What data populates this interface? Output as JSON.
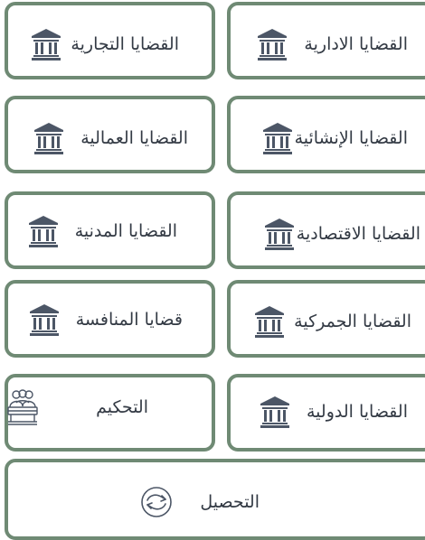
{
  "colors": {
    "card_border": "#6f8a74",
    "icon": "#4c5666",
    "text": "#333a44",
    "background": "#ffffff"
  },
  "cards": [
    {
      "label": "القضايا الادارية",
      "icon": "courthouse-icon"
    },
    {
      "label": "القضايا التجارية",
      "icon": "courthouse-icon"
    },
    {
      "label": "القضايا الإنشائية",
      "icon": "courthouse-icon"
    },
    {
      "label": "القضايا العمالية",
      "icon": "courthouse-icon"
    },
    {
      "label": "القضايا الاقتصادية",
      "icon": "courthouse-icon"
    },
    {
      "label": "القضايا المدنية",
      "icon": "courthouse-icon"
    },
    {
      "label": "القضايا الجمركية",
      "icon": "courthouse-icon"
    },
    {
      "label": "قضايا المنافسة",
      "icon": "courthouse-icon"
    },
    {
      "label": "القضايا الدولية",
      "icon": "courthouse-icon"
    },
    {
      "label": "التحكيم",
      "icon": "arbitration-panel-icon"
    },
    {
      "label": "التحصيل",
      "icon": "collection-exchange-icon"
    }
  ]
}
